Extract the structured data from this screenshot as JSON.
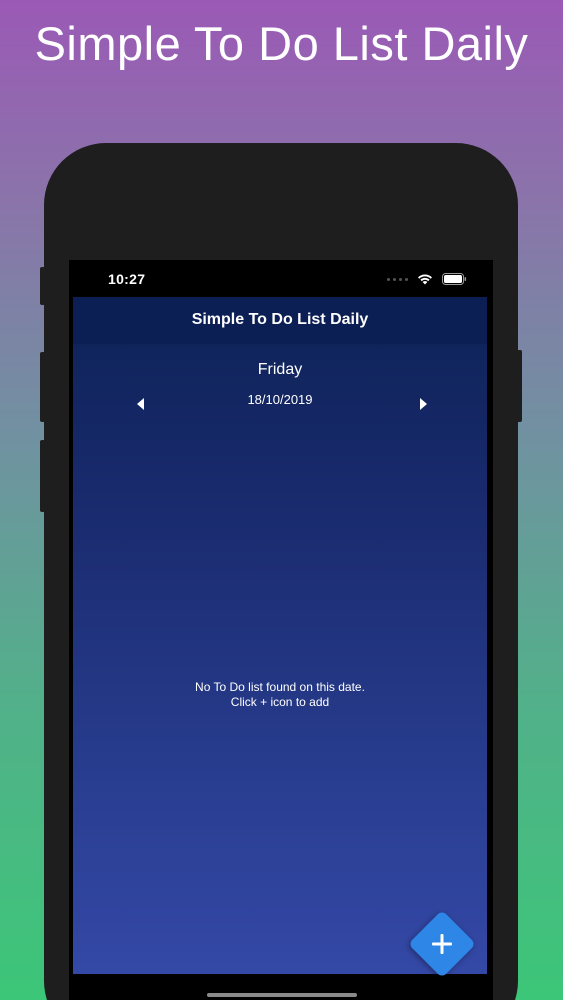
{
  "promo": {
    "title": "Simple To Do List Daily"
  },
  "status_bar": {
    "time": "10:27",
    "icons": [
      "signal-icon",
      "wifi-icon",
      "battery-icon"
    ]
  },
  "app": {
    "nav_title": "Simple To Do List Daily",
    "day": "Friday",
    "date": "18/10/2019",
    "prev_icon": "triangle-left-icon",
    "next_icon": "triangle-right-icon",
    "empty_line1": "No To Do list found on this date.",
    "empty_line2": "Click + icon to add",
    "add_icon": "plus-icon"
  },
  "colors": {
    "navbar": "#0c1f54",
    "fab": "#2e86e6",
    "background_top": "#0d2257",
    "background_bottom": "#3448a6"
  }
}
